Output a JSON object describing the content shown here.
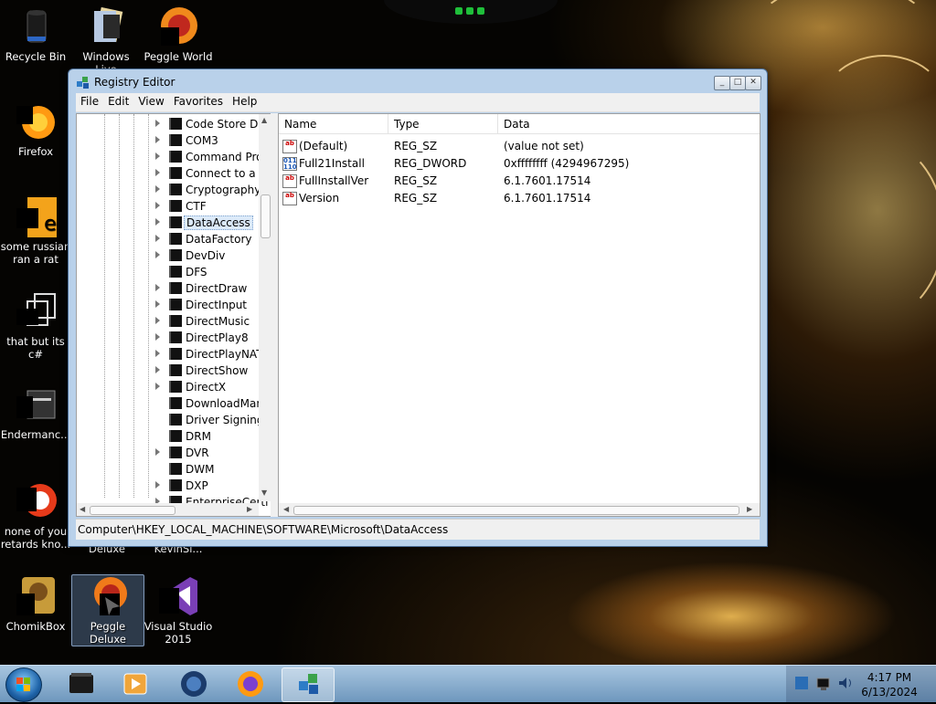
{
  "desktop": {
    "icons": [
      {
        "label": "Recycle Bin"
      },
      {
        "label": "Windows Live"
      },
      {
        "label": "Peggle World"
      },
      {
        "label": "Firefox"
      },
      {
        "label": "some russian ran a rat"
      },
      {
        "label": "that but its c#"
      },
      {
        "label": "Endermanc..."
      },
      {
        "label": "none of you retards kno..."
      },
      {
        "label": "Deluxe"
      },
      {
        "label": "KevinSl..."
      },
      {
        "label": "ChomikBox"
      },
      {
        "label": "Peggle Deluxe"
      },
      {
        "label": "Visual Studio 2015"
      }
    ]
  },
  "window": {
    "title": "Registry Editor",
    "menu": [
      "File",
      "Edit",
      "View",
      "Favorites",
      "Help"
    ],
    "tree": [
      {
        "label": "Code Store Da",
        "expandable": true
      },
      {
        "label": "COM3",
        "expandable": true
      },
      {
        "label": "Command Pro",
        "expandable": true
      },
      {
        "label": "Connect to a N",
        "expandable": true
      },
      {
        "label": "Cryptography",
        "expandable": true
      },
      {
        "label": "CTF",
        "expandable": true
      },
      {
        "label": "DataAccess",
        "expandable": true,
        "selected": true
      },
      {
        "label": "DataFactory",
        "expandable": true
      },
      {
        "label": "DevDiv",
        "expandable": true
      },
      {
        "label": "DFS",
        "expandable": false
      },
      {
        "label": "DirectDraw",
        "expandable": true
      },
      {
        "label": "DirectInput",
        "expandable": true
      },
      {
        "label": "DirectMusic",
        "expandable": true
      },
      {
        "label": "DirectPlay8",
        "expandable": true
      },
      {
        "label": "DirectPlayNAT",
        "expandable": true
      },
      {
        "label": "DirectShow",
        "expandable": true
      },
      {
        "label": "DirectX",
        "expandable": true
      },
      {
        "label": "DownloadMan",
        "expandable": false
      },
      {
        "label": "Driver Signing",
        "expandable": false
      },
      {
        "label": "DRM",
        "expandable": false
      },
      {
        "label": "DVR",
        "expandable": true
      },
      {
        "label": "DWM",
        "expandable": false
      },
      {
        "label": "DXP",
        "expandable": true
      },
      {
        "label": "EnterpriseCerti",
        "expandable": true
      }
    ],
    "columns": {
      "name": "Name",
      "type": "Type",
      "data": "Data"
    },
    "values": [
      {
        "name": "(Default)",
        "type": "REG_SZ",
        "data": "(value not set)",
        "icon": "string-value-icon"
      },
      {
        "name": "Full21Install",
        "type": "REG_DWORD",
        "data": "0xffffffff (4294967295)",
        "icon": "binary-value-icon"
      },
      {
        "name": "FullInstallVer",
        "type": "REG_SZ",
        "data": "6.1.7601.17514",
        "icon": "string-value-icon"
      },
      {
        "name": "Version",
        "type": "REG_SZ",
        "data": "6.1.7601.17514",
        "icon": "string-value-icon"
      }
    ],
    "status_path": "Computer\\HKEY_LOCAL_MACHINE\\SOFTWARE\\Microsoft\\DataAccess"
  },
  "taskbar": {
    "time": "4:17 PM",
    "date": "6/13/2024"
  }
}
